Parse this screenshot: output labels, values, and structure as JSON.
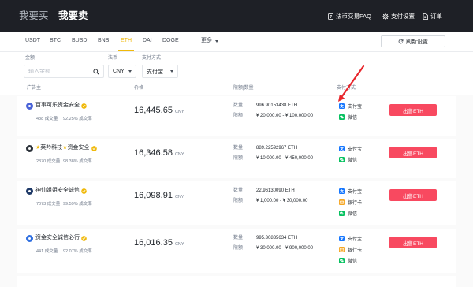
{
  "header": {
    "tabs": [
      {
        "label": "我要买",
        "active": false
      },
      {
        "label": "我要卖",
        "active": true
      }
    ],
    "links": [
      {
        "label": "法币交易FAQ",
        "icon": "faq-icon"
      },
      {
        "label": "支付设置",
        "icon": "gear-icon"
      },
      {
        "label": "订单",
        "icon": "order-icon"
      }
    ]
  },
  "assets": {
    "items": [
      "USDT",
      "BTC",
      "BUSD",
      "BNB",
      "ETH",
      "DAI",
      "DOGE"
    ],
    "active": "ETH",
    "more_label": "更多",
    "refresh_label": "刷新设置",
    "refresh_icon": "refresh-icon"
  },
  "filters": {
    "amount": {
      "label": "金额",
      "placeholder": "输入金额",
      "value": "",
      "icon": "search-icon"
    },
    "fiat": {
      "label": "法币",
      "value": "CNY"
    },
    "payment": {
      "label": "支付方式",
      "value": "支付宝"
    }
  },
  "table": {
    "headers": {
      "advertiser": "广告主",
      "price": "价格",
      "limit_qty": "限额|数量",
      "payment": "支付方式"
    },
    "orders_label": "成交量",
    "completion_label": "成交率",
    "currency": "CNY",
    "qty_label": "数量",
    "limit_label": "限额",
    "action_label": "出售ETH",
    "rows": [
      {
        "name": "百事可乐资金安全",
        "verified": true,
        "avatar_color": "#4a63d8",
        "orders": "488",
        "completion": "92.25%",
        "price": "16,445.65",
        "qty": "996.90153438 ETH",
        "limit": "¥ 20,000.00 - ¥ 100,000.00",
        "payments": [
          {
            "label": "支付宝",
            "icon": "alipay-icon"
          },
          {
            "label": "微信",
            "icon": "wechat-icon"
          }
        ]
      },
      {
        "name": "★莱羚科技★资金安全",
        "verified": true,
        "avatar_color": "#2b3139",
        "orders": "2370",
        "completion": "98.38%",
        "price": "16,346.58",
        "qty": "889.22592967 ETH",
        "limit": "¥ 10,000.00 - ¥ 450,000.00",
        "payments": [
          {
            "label": "支付宝",
            "icon": "alipay-icon"
          },
          {
            "label": "微信",
            "icon": "wechat-icon"
          }
        ]
      },
      {
        "name": "神仙姐姐安全诚信",
        "verified": true,
        "avatar_color": "#1f3a68",
        "orders": "7073",
        "completion": "99.59%",
        "price": "16,098.91",
        "qty": "22.96130090 ETH",
        "limit": "¥ 1,000.00 - ¥ 30,000.00",
        "payments": [
          {
            "label": "支付宝",
            "icon": "alipay-icon"
          },
          {
            "label": "银行卡",
            "icon": "bank-card-icon"
          },
          {
            "label": "微信",
            "icon": "wechat-icon"
          }
        ]
      },
      {
        "name": "资金安全诚信必行",
        "verified": true,
        "avatar_color": "#2f6fe0",
        "orders": "441",
        "completion": "92.07%",
        "price": "16,016.35",
        "qty": "995.30835634 ETH",
        "limit": "¥ 30,000.00 - ¥ 900,000.00",
        "payments": [
          {
            "label": "支付宝",
            "icon": "alipay-icon"
          },
          {
            "label": "银行卡",
            "icon": "bank-card-icon"
          },
          {
            "label": "微信",
            "icon": "wechat-icon"
          }
        ]
      }
    ]
  },
  "colors": {
    "accent": "#f0b90b",
    "sell": "#f84960",
    "header_bg": "#1e2026",
    "alipay": "#1677ff",
    "wechat": "#07c160",
    "bank": "#f5a623",
    "annotation": "#e8262c"
  }
}
